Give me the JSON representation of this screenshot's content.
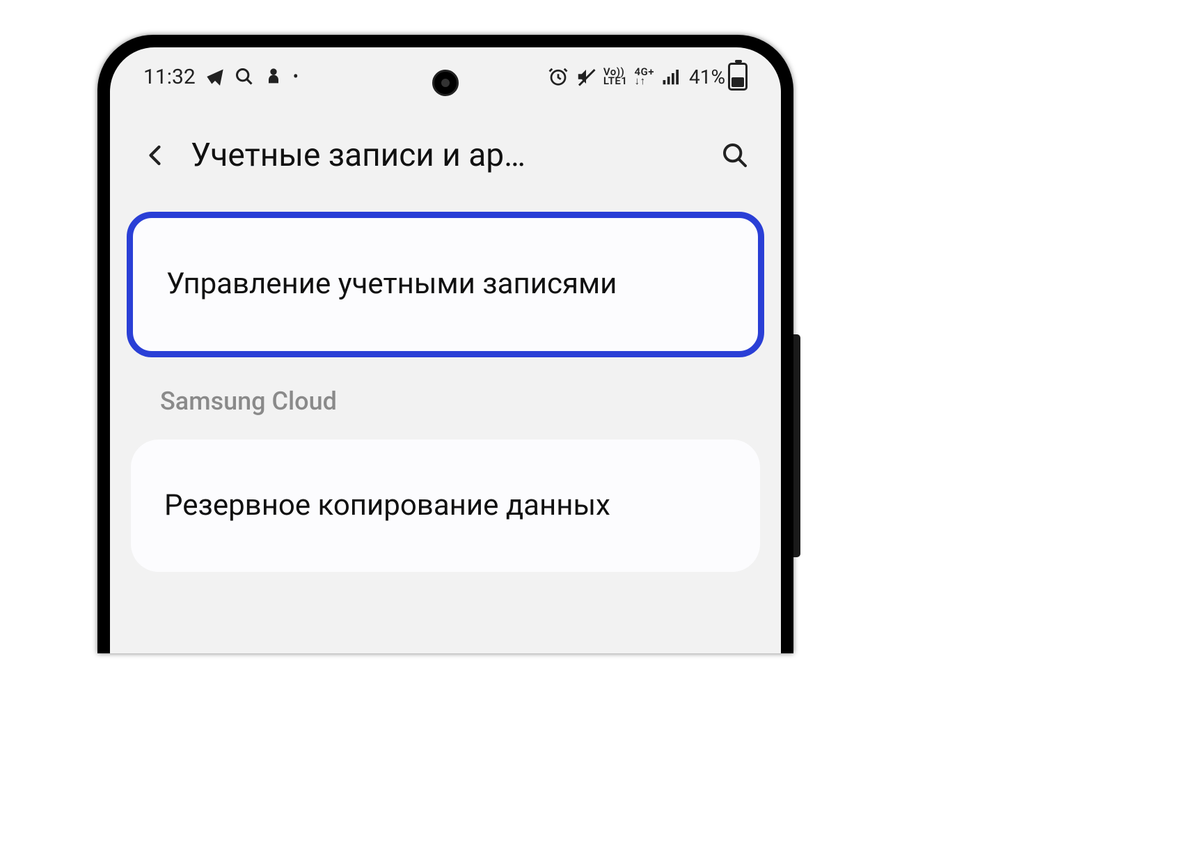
{
  "status_bar": {
    "time": "11:32",
    "net_volte": "Vo))",
    "net_lte": "LTE1",
    "net_4g": "4G+",
    "net_arrows": "↓↑",
    "battery_pct": "41%"
  },
  "app_bar": {
    "title": "Учетные записи и ар…"
  },
  "items": {
    "manage_accounts": "Управление учетными записями",
    "section_samsung_cloud": "Samsung Cloud",
    "backup_data": "Резервное копирование данных"
  },
  "highlight_color": "#2a3fd6"
}
